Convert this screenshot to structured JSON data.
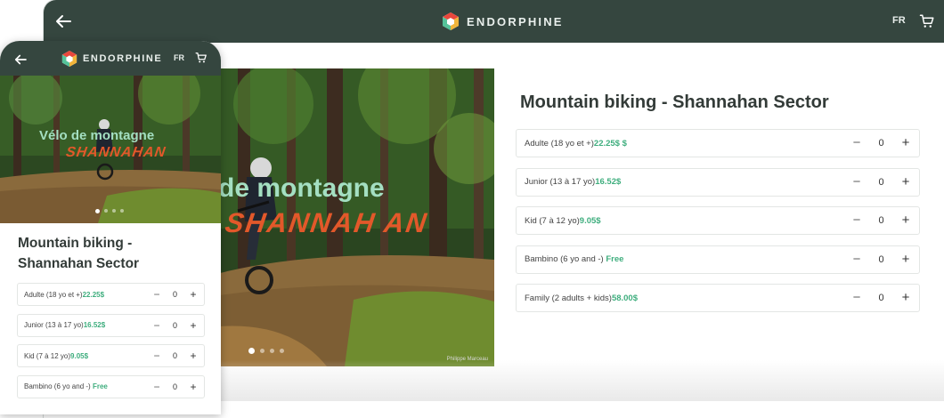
{
  "colors": {
    "header_bg": "#35463f",
    "price_green": "#3fae7e",
    "hero_title": "#a4dfc2",
    "hero_script": "#e3582a"
  },
  "brand": {
    "name": "ENDORPHINE",
    "logo_icon": "hexagon-logo-icon"
  },
  "header": {
    "language": "FR",
    "back_icon": "arrow-left-icon",
    "cart_icon": "cart-icon"
  },
  "desktop": {
    "hero": {
      "title": "de montagne",
      "script": "SHANNAH AN",
      "credit": "Philippe Marceau",
      "slides": 4,
      "active_slide": 1
    },
    "product_title": "Mountain biking - Shannahan Sector",
    "tickets": [
      {
        "name": "Adulte (18 yo et +)",
        "price": "22.25$  $",
        "qty": "0"
      },
      {
        "name": "Junior (13 à 17 yo)",
        "price": "16.52$",
        "qty": "0"
      },
      {
        "name": "Kid (7 à 12 yo)",
        "price": "9.05$",
        "qty": "0"
      },
      {
        "name": "Bambino (6 yo and -) ",
        "price": "Free",
        "qty": "0"
      },
      {
        "name": "Family (2 adults + kids)",
        "price": "58.00$",
        "qty": "0"
      }
    ]
  },
  "mobile": {
    "hero": {
      "title": "Vélo de montagne",
      "script": "SHANNAHAN",
      "slides": 4,
      "active_slide": 1
    },
    "product_title": "Mountain biking - Shannahan Sector",
    "tickets": [
      {
        "name": "Adulte (18 yo et +)",
        "price": "22.25$",
        "qty": "0"
      },
      {
        "name": "Junior (13 à 17 yo)",
        "price": "16.52$",
        "qty": "0"
      },
      {
        "name": "Kid (7 à 12 yo)",
        "price": "9.05$",
        "qty": "0"
      },
      {
        "name": "Bambino (6 yo and -) ",
        "price": "Free",
        "qty": "0"
      }
    ]
  },
  "controls": {
    "minus": "−",
    "plus": "+"
  }
}
